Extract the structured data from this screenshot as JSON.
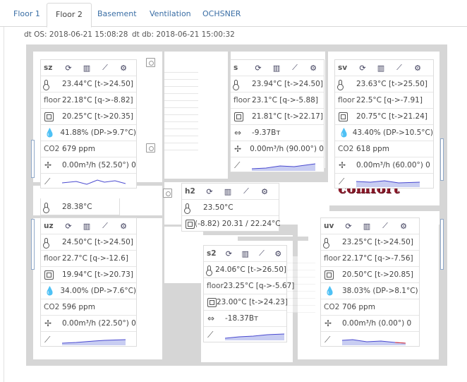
{
  "tabs": [
    "Floor 1",
    "Floor 2",
    "Basement",
    "Ventilation",
    "OCHSNER"
  ],
  "active_tab": "Floor 2",
  "dt_os": "dt OS: 2018-06-21 15:08:28",
  "dt_db": "dt db: 2018-06-21 15:00:32",
  "rooms": {
    "sz": {
      "title": "sz",
      "temp": "23.44°C [t->24.50]",
      "floor": "22.18°C [q->-8.82]",
      "rad": "20.25°C [t->20.35]",
      "hum": "41.88% (DP->9.7°C)",
      "co2": "679 ppm",
      "vent": "0.00m³/h (52.50°) 0"
    },
    "s": {
      "title": "s",
      "temp": "23.94°C [t->24.50]",
      "floor": "23.1°C [q->-5.88]",
      "rad": "21.81°C [t->22.17]",
      "power": "-9.37Вт",
      "vent": "0.00m³/h (90.00°) 0"
    },
    "sv": {
      "title": "sv",
      "temp": "23.63°C [t->25.50]",
      "floor": "22.5°C [q->-7.91]",
      "rad": "20.75°C [t->21.24]",
      "hum": "43.40% (DP->10.5°C)",
      "co2": "618 ppm",
      "vent": "0.00m³/h (60.00°) 0"
    },
    "hall_temp": "28.38°C",
    "h2": {
      "title": "h2",
      "temp": "23.50°C",
      "rad": "(-8.82) 20.31 / 22.24°C"
    },
    "uz": {
      "title": "uz",
      "temp": "24.50°C [t->24.50]",
      "floor": "22.7°C [q->-12.6]",
      "rad": "19.94°C [t->20.73]",
      "hum": "34.00% (DP->7.6°C)",
      "co2": "596 ppm",
      "vent": "0.00m³/h (22.50°) 0"
    },
    "s2": {
      "title": "s2",
      "temp": "24.06°C [t->26.50]",
      "floor": "23.25°C [q->-5.67]",
      "rad": "23.00°C [t->24.23]",
      "power": "-18.37Вт"
    },
    "uv": {
      "title": "uv",
      "temp": "23.25°C [t->24.50]",
      "floor": "22.17°C [q->-7.56]",
      "rad": "20.50°C [t->20.85]",
      "hum": "38.03% (DP->8.1°C)",
      "co2": "706 ppm",
      "vent": "0.00m³/h (0.00°) 0"
    }
  },
  "labels": {
    "floor": "floor",
    "co2": "CO2"
  },
  "logo_text": "comfort",
  "colors": {
    "spark_line": "#4a4ad0",
    "spark_fill": "#c8cdf2",
    "spark_red": "#e03030",
    "logo": "#8c1a2a"
  }
}
